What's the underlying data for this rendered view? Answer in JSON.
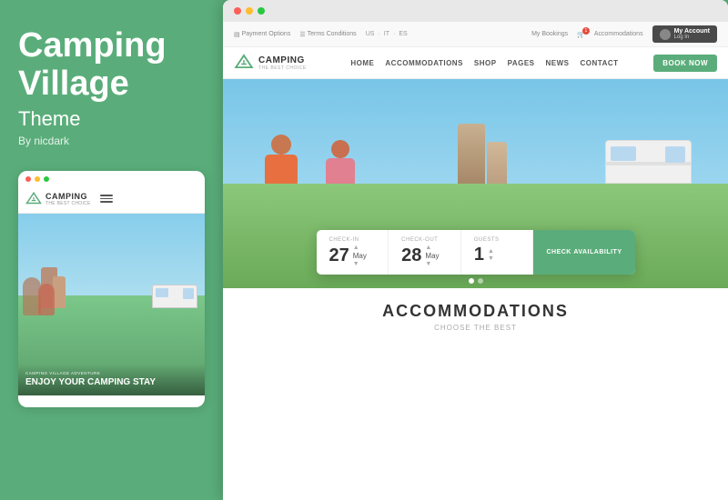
{
  "left": {
    "brand_name_line1": "Camping",
    "brand_name_line2": "Village",
    "brand_theme": "Theme",
    "brand_author": "By nicdark"
  },
  "mobile_preview": {
    "dots": [
      "red",
      "yellow",
      "green"
    ],
    "logo_name": "CAMPING",
    "logo_tagline": "THE BEST CHOICE",
    "hero_small_text": "CAMPING VILLAGE ADVENTURE",
    "hero_big_text": "ENJOY YOUR CAMPING STAY"
  },
  "browser": {
    "dots": [
      "red",
      "yellow",
      "green"
    ]
  },
  "website": {
    "topbar": {
      "payment_options": "Payment Options",
      "terms_conditions": "Terms Conditions",
      "lang_us": "US",
      "lang_it": "IT",
      "lang_es": "ES",
      "my_bookings": "My Bookings",
      "accommodations": "Accommodations",
      "my_account": "My Account",
      "log_in": "Log In"
    },
    "nav": {
      "logo_name": "CAMPING",
      "logo_tagline": "THE BEST CHOICE",
      "links": [
        "HOME",
        "ACCOMMODATIONS",
        "SHOP",
        "PAGES",
        "NEWS",
        "CONTACT"
      ],
      "book_now": "BOOK NOW"
    },
    "booking_widget": {
      "checkin_label": "CHECK-IN",
      "checkin_day": "27",
      "checkin_month": "May",
      "checkout_label": "CHECK-OUT",
      "checkout_day": "28",
      "checkout_month": "May",
      "guests_label": "GUESTS",
      "guests_num": "1",
      "check_btn_line1": "CHECK",
      "check_btn_line2": "AVAILABILITY"
    },
    "accommodations": {
      "title": "ACCOMMODATIONS",
      "subtitle": "CHOOSE THE BEST"
    }
  }
}
